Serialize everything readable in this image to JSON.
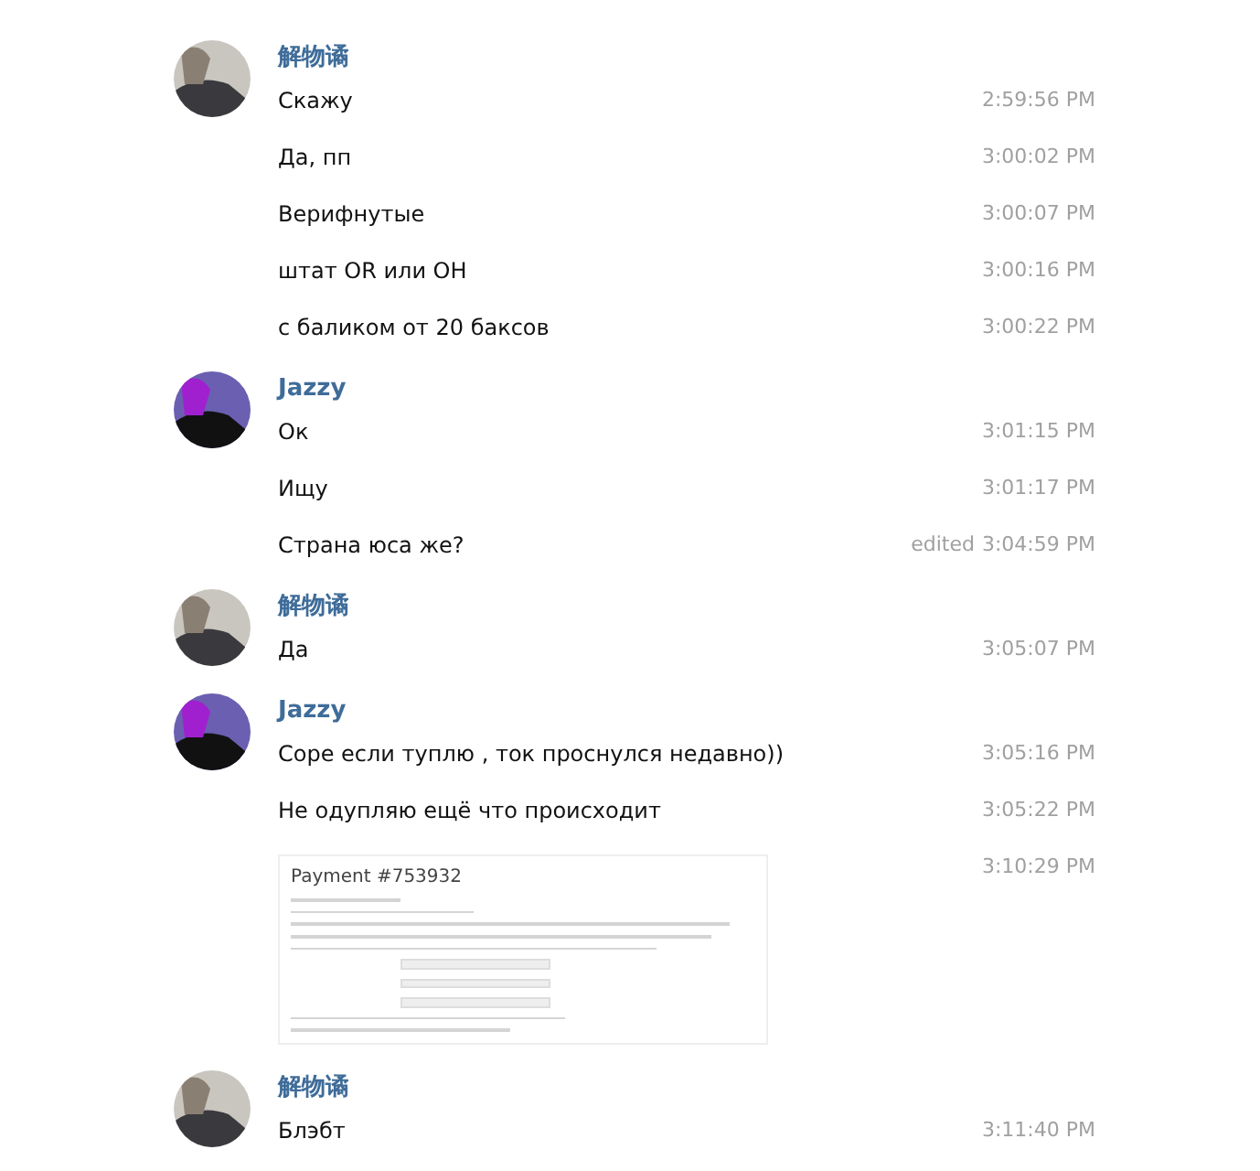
{
  "groups": [
    {
      "author": "解物谲",
      "kind": "dim",
      "messages": [
        {
          "kind": "text",
          "text": "Скажу",
          "time": "2:59:56 PM"
        },
        {
          "kind": "text",
          "text": "Да, пп",
          "time": "3:00:02 PM"
        },
        {
          "kind": "text",
          "text": "Верифнутые",
          "time": "3:00:07 PM"
        },
        {
          "kind": "text",
          "text": "штат OR или OH",
          "time": "3:00:16 PM"
        },
        {
          "kind": "text",
          "text": "с баликом от 20 баксов",
          "time": "3:00:22 PM"
        }
      ]
    },
    {
      "author": "Jazzy",
      "kind": "violet",
      "messages": [
        {
          "kind": "text",
          "text": "Ок",
          "time": "3:01:15 PM"
        },
        {
          "kind": "text",
          "text": "Ищу",
          "time": "3:01:17 PM"
        },
        {
          "kind": "text",
          "text": "Страна юса же?",
          "time": "3:04:59 PM",
          "edited_label": "edited"
        }
      ]
    },
    {
      "author": "解物谲",
      "kind": "dim",
      "messages": [
        {
          "kind": "text",
          "text": "Да",
          "time": "3:05:07 PM"
        }
      ]
    },
    {
      "author": "Jazzy",
      "kind": "violet",
      "messages": [
        {
          "kind": "text",
          "text": "Соре если туплю , ток проснулся недавно))",
          "time": "3:05:16 PM"
        },
        {
          "kind": "text",
          "text": "Не одупляю ещё что происходит",
          "time": "3:05:22 PM"
        },
        {
          "kind": "image",
          "title": "Payment #753932",
          "time": "3:10:29 PM"
        }
      ]
    },
    {
      "author": "解物谲",
      "kind": "dim",
      "messages": [
        {
          "kind": "text",
          "text": "Блэбт",
          "time": "3:11:40 PM"
        }
      ]
    }
  ]
}
